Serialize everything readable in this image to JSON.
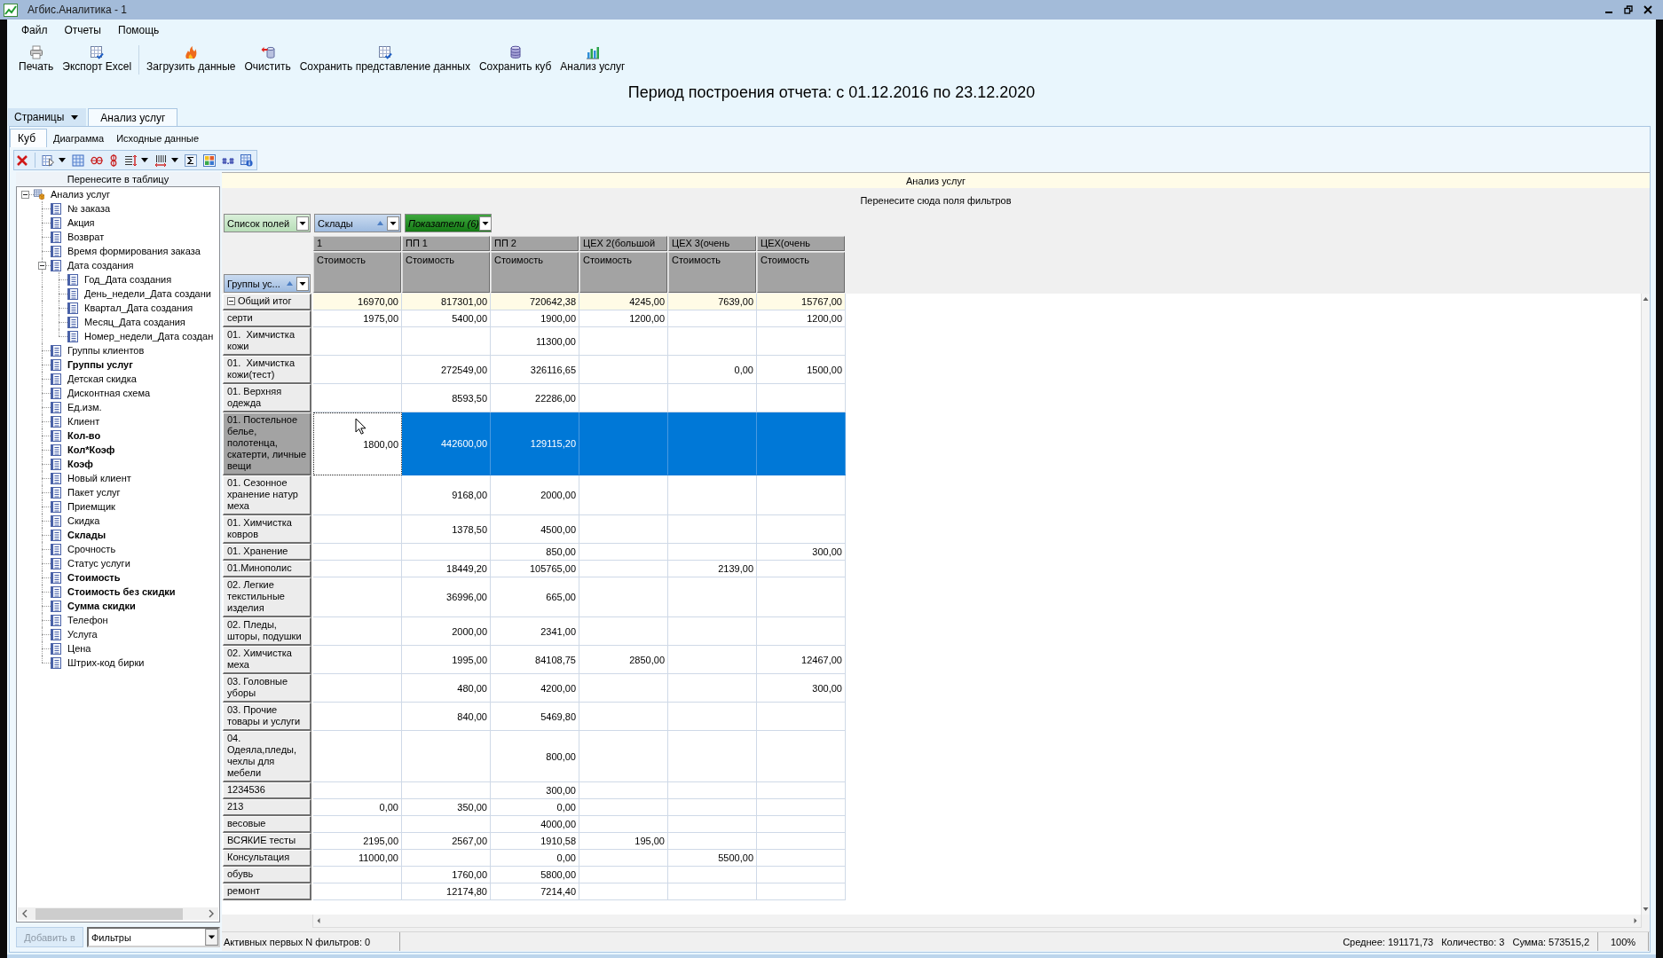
{
  "window": {
    "title": "Агбис.Аналитика - 1"
  },
  "menu": [
    "Файл",
    "Отчеты",
    "Помощь"
  ],
  "toolbar": [
    {
      "buttons": [
        "Печать",
        "Экспорт Excel"
      ]
    },
    {
      "buttons": [
        "Загрузить данные",
        "Очистить",
        "Сохранить представление данных",
        "Сохранить куб",
        "Анализ услуг"
      ]
    }
  ],
  "report_period": "Период построения отчета: с 01.12.2016 по 23.12.2020",
  "page_tabs": {
    "menu": "Страницы",
    "tabs": [
      {
        "label": "Анализ услуг",
        "selected": true
      }
    ]
  },
  "view_tabs": [
    {
      "label": "Куб",
      "selected": true
    },
    {
      "label": "Диаграмма",
      "selected": false
    },
    {
      "label": "Исходные данные",
      "selected": false
    }
  ],
  "field_list": {
    "title": "Перенесите в таблицу",
    "tree": [
      {
        "label": "Анализ услуг",
        "in_use": false,
        "expanded": true,
        "children": [
          {
            "label": "№ заказа",
            "in_use": false
          },
          {
            "label": "Акция",
            "in_use": false
          },
          {
            "label": "Возврат",
            "in_use": false
          },
          {
            "label": "Время формирования заказа",
            "in_use": false
          },
          {
            "label": "Дата создания",
            "in_use": false,
            "expanded": true,
            "children": [
              {
                "label": "Год_Дата создания",
                "in_use": false
              },
              {
                "label": "День_недели_Дата создани",
                "in_use": false
              },
              {
                "label": "Квартал_Дата создания",
                "in_use": false
              },
              {
                "label": "Месяц_Дата создания",
                "in_use": false
              },
              {
                "label": "Номер_недели_Дата создан",
                "in_use": false
              }
            ]
          },
          {
            "label": "Группы клиентов",
            "in_use": false
          },
          {
            "label": "Группы услуг",
            "in_use": true
          },
          {
            "label": "Детская скидка",
            "in_use": false
          },
          {
            "label": "Дисконтная схема",
            "in_use": false
          },
          {
            "label": "Ед.изм.",
            "in_use": false
          },
          {
            "label": "Клиент",
            "in_use": false
          },
          {
            "label": "Кол-во",
            "in_use": true
          },
          {
            "label": "Кол*Коэф",
            "in_use": true
          },
          {
            "label": "Коэф",
            "in_use": true
          },
          {
            "label": "Новый клиент",
            "in_use": false
          },
          {
            "label": "Пакет услуг",
            "in_use": false
          },
          {
            "label": "Приемщик",
            "in_use": false
          },
          {
            "label": "Скидка",
            "in_use": false
          },
          {
            "label": "Склады",
            "in_use": true
          },
          {
            "label": "Срочность",
            "in_use": false
          },
          {
            "label": "Статус услуги",
            "in_use": false
          },
          {
            "label": "Стоимость",
            "in_use": true
          },
          {
            "label": "Стоимость без скидки",
            "in_use": true
          },
          {
            "label": "Сумма скидки",
            "in_use": true
          },
          {
            "label": "Телефон",
            "in_use": false
          },
          {
            "label": "Услуга",
            "in_use": false
          },
          {
            "label": "Цена",
            "in_use": false
          },
          {
            "label": "Штрих-код бирки",
            "in_use": false
          }
        ]
      }
    ],
    "add_button": {
      "label": "Добавить в",
      "disabled": true
    },
    "target": "Фильтры"
  },
  "pivot": {
    "title": "Анализ услуг",
    "filter_hint": "Перенесите сюда поля фильтров",
    "field_buttons": [
      {
        "label": "Список полей",
        "kind": "field_list",
        "sorted": false
      },
      {
        "label": "Склады",
        "kind": "column",
        "sorted": true
      },
      {
        "label": "Показатели (6)",
        "kind": "data",
        "sorted": false
      }
    ],
    "row_field": {
      "label": "Группы ус...",
      "kind": "row",
      "sorted": true
    },
    "columns": [
      {
        "label": "1",
        "measure": "Стоимость"
      },
      {
        "label": "ПП 1",
        "measure": "Стоимость"
      },
      {
        "label": "ПП 2",
        "measure": "Стоимость"
      },
      {
        "label": "ЦЕХ 2(большой",
        "measure": "Стоимость"
      },
      {
        "label": "ЦЕХ 3(очень",
        "measure": "Стоимость"
      },
      {
        "label": "ЦЕХ(очень",
        "measure": "Стоимость"
      }
    ],
    "total_row": {
      "label": "Общий итог",
      "expanded": true,
      "cells": [
        {
          "value": "16970,00",
          "selected": false,
          "focused": false
        },
        {
          "value": "817301,00",
          "selected": false,
          "focused": false
        },
        {
          "value": "720642,38",
          "selected": false,
          "focused": false
        },
        {
          "value": "4245,00",
          "selected": false,
          "focused": false
        },
        {
          "value": "7639,00",
          "selected": false,
          "focused": false
        },
        {
          "value": "15767,00",
          "selected": false,
          "focused": false
        }
      ]
    },
    "rows": [
      {
        "label": "серти",
        "selected": false,
        "cells": [
          {
            "value": "1975,00",
            "selected": false,
            "focused": false
          },
          {
            "value": "5400,00",
            "selected": false,
            "focused": false
          },
          {
            "value": "1900,00",
            "selected": false,
            "focused": false
          },
          {
            "value": "1200,00",
            "selected": false,
            "focused": false
          },
          {
            "selected": false,
            "focused": false
          },
          {
            "value": "1200,00",
            "selected": false,
            "focused": false
          }
        ]
      },
      {
        "label": "01.  Химчистка кожи",
        "selected": false,
        "cells": [
          {
            "selected": false,
            "focused": false
          },
          {
            "selected": false,
            "focused": false
          },
          {
            "value": "11300,00",
            "selected": false,
            "focused": false
          },
          {
            "selected": false,
            "focused": false
          },
          {
            "selected": false,
            "focused": false
          },
          {
            "selected": false,
            "focused": false
          }
        ]
      },
      {
        "label": "01.  Химчистка кожи(тест)",
        "selected": false,
        "cells": [
          {
            "selected": false,
            "focused": false
          },
          {
            "value": "272549,00",
            "selected": false,
            "focused": false
          },
          {
            "value": "326116,65",
            "selected": false,
            "focused": false
          },
          {
            "selected": false,
            "focused": false
          },
          {
            "value": "0,00",
            "selected": false,
            "focused": false
          },
          {
            "value": "1500,00",
            "selected": false,
            "focused": false
          }
        ]
      },
      {
        "label": "01. Верхняя одежда",
        "selected": false,
        "cells": [
          {
            "selected": false,
            "focused": false
          },
          {
            "value": "8593,50",
            "selected": false,
            "focused": false
          },
          {
            "value": "22286,00",
            "selected": false,
            "focused": false
          },
          {
            "selected": false,
            "focused": false
          },
          {
            "selected": false,
            "focused": false
          },
          {
            "selected": false,
            "focused": false
          }
        ]
      },
      {
        "label": "01. Постельное белье, полотенца, скатерти, личные вещи",
        "selected": true,
        "cells": [
          {
            "value": "1800,00",
            "selected": false,
            "focused": true
          },
          {
            "value": "442600,00",
            "selected": true,
            "focused": false
          },
          {
            "value": "129115,20",
            "selected": true,
            "focused": false
          },
          {
            "selected": true,
            "focused": false
          },
          {
            "selected": true,
            "focused": false
          },
          {
            "selected": true,
            "focused": false
          }
        ]
      },
      {
        "label": "01. Сезонное хранение натур меха",
        "selected": false,
        "cells": [
          {
            "selected": false,
            "focused": false
          },
          {
            "value": "9168,00",
            "selected": false,
            "focused": false
          },
          {
            "value": "2000,00",
            "selected": false,
            "focused": false
          },
          {
            "selected": false,
            "focused": false
          },
          {
            "selected": false,
            "focused": false
          },
          {
            "selected": false,
            "focused": false
          }
        ]
      },
      {
        "label": "01. Химчистка ковров",
        "selected": false,
        "cells": [
          {
            "selected": false,
            "focused": false
          },
          {
            "value": "1378,50",
            "selected": false,
            "focused": false
          },
          {
            "value": "4500,00",
            "selected": false,
            "focused": false
          },
          {
            "selected": false,
            "focused": false
          },
          {
            "selected": false,
            "focused": false
          },
          {
            "selected": false,
            "focused": false
          }
        ]
      },
      {
        "label": "01. Хранение",
        "selected": false,
        "cells": [
          {
            "selected": false,
            "focused": false
          },
          {
            "selected": false,
            "focused": false
          },
          {
            "value": "850,00",
            "selected": false,
            "focused": false
          },
          {
            "selected": false,
            "focused": false
          },
          {
            "selected": false,
            "focused": false
          },
          {
            "value": "300,00",
            "selected": false,
            "focused": false
          }
        ]
      },
      {
        "label": "01.Минополис",
        "selected": false,
        "cells": [
          {
            "selected": false,
            "focused": false
          },
          {
            "value": "18449,20",
            "selected": false,
            "focused": false
          },
          {
            "value": "105765,00",
            "selected": false,
            "focused": false
          },
          {
            "selected": false,
            "focused": false
          },
          {
            "value": "2139,00",
            "selected": false,
            "focused": false
          },
          {
            "selected": false,
            "focused": false
          }
        ]
      },
      {
        "label": "02. Легкие текстильные изделия",
        "selected": false,
        "cells": [
          {
            "selected": false,
            "focused": false
          },
          {
            "value": "36996,00",
            "selected": false,
            "focused": false
          },
          {
            "value": "665,00",
            "selected": false,
            "focused": false
          },
          {
            "selected": false,
            "focused": false
          },
          {
            "selected": false,
            "focused": false
          },
          {
            "selected": false,
            "focused": false
          }
        ]
      },
      {
        "label": "02. Пледы, шторы, подушки",
        "selected": false,
        "cells": [
          {
            "selected": false,
            "focused": false
          },
          {
            "value": "2000,00",
            "selected": false,
            "focused": false
          },
          {
            "value": "2341,00",
            "selected": false,
            "focused": false
          },
          {
            "selected": false,
            "focused": false
          },
          {
            "selected": false,
            "focused": false
          },
          {
            "selected": false,
            "focused": false
          }
        ]
      },
      {
        "label": "02. Химчистка меха",
        "selected": false,
        "cells": [
          {
            "selected": false,
            "focused": false
          },
          {
            "value": "1995,00",
            "selected": false,
            "focused": false
          },
          {
            "value": "84108,75",
            "selected": false,
            "focused": false
          },
          {
            "value": "2850,00",
            "selected": false,
            "focused": false
          },
          {
            "selected": false,
            "focused": false
          },
          {
            "value": "12467,00",
            "selected": false,
            "focused": false
          }
        ]
      },
      {
        "label": "03. Головные уборы",
        "selected": false,
        "cells": [
          {
            "selected": false,
            "focused": false
          },
          {
            "value": "480,00",
            "selected": false,
            "focused": false
          },
          {
            "value": "4200,00",
            "selected": false,
            "focused": false
          },
          {
            "selected": false,
            "focused": false
          },
          {
            "selected": false,
            "focused": false
          },
          {
            "value": "300,00",
            "selected": false,
            "focused": false
          }
        ]
      },
      {
        "label": "03. Прочие товары и услуги",
        "selected": false,
        "cells": [
          {
            "selected": false,
            "focused": false
          },
          {
            "value": "840,00",
            "selected": false,
            "focused": false
          },
          {
            "value": "5469,80",
            "selected": false,
            "focused": false
          },
          {
            "selected": false,
            "focused": false
          },
          {
            "selected": false,
            "focused": false
          },
          {
            "selected": false,
            "focused": false
          }
        ]
      },
      {
        "label": "04. Одеяла,пледы, чехлы для мебели",
        "selected": false,
        "cells": [
          {
            "selected": false,
            "focused": false
          },
          {
            "selected": false,
            "focused": false
          },
          {
            "value": "800,00",
            "selected": false,
            "focused": false
          },
          {
            "selected": false,
            "focused": false
          },
          {
            "selected": false,
            "focused": false
          },
          {
            "selected": false,
            "focused": false
          }
        ]
      },
      {
        "label": "1234536",
        "selected": false,
        "cells": [
          {
            "selected": false,
            "focused": false
          },
          {
            "selected": false,
            "focused": false
          },
          {
            "value": "300,00",
            "selected": false,
            "focused": false
          },
          {
            "selected": false,
            "focused": false
          },
          {
            "selected": false,
            "focused": false
          },
          {
            "selected": false,
            "focused": false
          }
        ]
      },
      {
        "label": "213",
        "selected": false,
        "cells": [
          {
            "value": "0,00",
            "selected": false,
            "focused": false
          },
          {
            "value": "350,00",
            "selected": false,
            "focused": false
          },
          {
            "value": "0,00",
            "selected": false,
            "focused": false
          },
          {
            "selected": false,
            "focused": false
          },
          {
            "selected": false,
            "focused": false
          },
          {
            "selected": false,
            "focused": false
          }
        ]
      },
      {
        "label": "весовые",
        "selected": false,
        "cells": [
          {
            "selected": false,
            "focused": false
          },
          {
            "selected": false,
            "focused": false
          },
          {
            "value": "4000,00",
            "selected": false,
            "focused": false
          },
          {
            "selected": false,
            "focused": false
          },
          {
            "selected": false,
            "focused": false
          },
          {
            "selected": false,
            "focused": false
          }
        ]
      },
      {
        "label": "ВСЯКИЕ тесты",
        "selected": false,
        "cells": [
          {
            "value": "2195,00",
            "selected": false,
            "focused": false
          },
          {
            "value": "2567,00",
            "selected": false,
            "focused": false
          },
          {
            "value": "1910,58",
            "selected": false,
            "focused": false
          },
          {
            "value": "195,00",
            "selected": false,
            "focused": false
          },
          {
            "selected": false,
            "focused": false
          },
          {
            "selected": false,
            "focused": false
          }
        ]
      },
      {
        "label": "Консультация",
        "selected": false,
        "cells": [
          {
            "value": "11000,00",
            "selected": false,
            "focused": false
          },
          {
            "selected": false,
            "focused": false
          },
          {
            "value": "0,00",
            "selected": false,
            "focused": false
          },
          {
            "selected": false,
            "focused": false
          },
          {
            "value": "5500,00",
            "selected": false,
            "focused": false
          },
          {
            "selected": false,
            "focused": false
          }
        ]
      },
      {
        "label": "обувь",
        "selected": false,
        "cells": [
          {
            "selected": false,
            "focused": false
          },
          {
            "value": "1760,00",
            "selected": false,
            "focused": false
          },
          {
            "value": "5800,00",
            "selected": false,
            "focused": false
          },
          {
            "selected": false,
            "focused": false
          },
          {
            "selected": false,
            "focused": false
          },
          {
            "selected": false,
            "focused": false
          }
        ]
      },
      {
        "label": "ремонт",
        "selected": false,
        "cells": [
          {
            "selected": false,
            "focused": false
          },
          {
            "value": "12174,80",
            "selected": false,
            "focused": false
          },
          {
            "value": "7214,40",
            "selected": false,
            "focused": false
          },
          {
            "selected": false,
            "focused": false
          },
          {
            "selected": false,
            "focused": false
          },
          {
            "selected": false,
            "focused": false
          }
        ]
      }
    ]
  },
  "status_bar": {
    "filters": "Активных первых N фильтров: 0",
    "summary": [
      "Среднее: 191171,73",
      "Количество: 3",
      "Сумма: 573515,2"
    ],
    "zoom": "100%"
  }
}
